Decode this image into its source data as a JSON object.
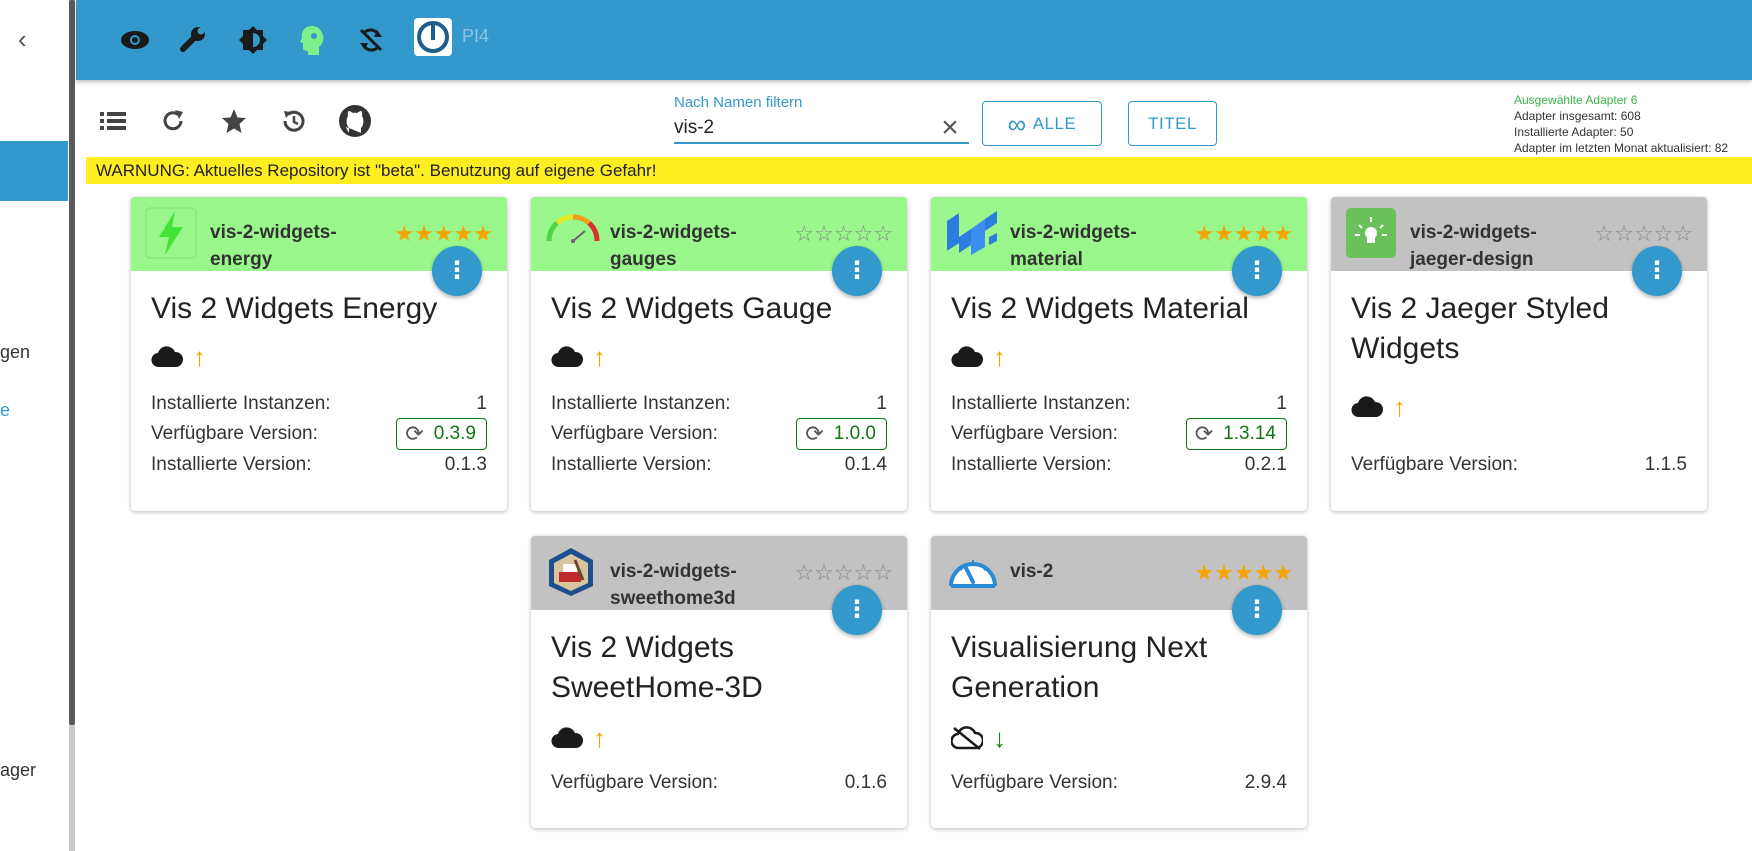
{
  "sidebar": {
    "fragments": [
      "gen",
      "e",
      "ager"
    ]
  },
  "appbar": {
    "host": "PI4",
    "icons": [
      "eye-icon",
      "wrench-icon",
      "theme-icon",
      "expert-mode-icon",
      "sync-off-icon"
    ]
  },
  "toolbar": {
    "filter_label": "Nach Namen filtern",
    "filter_value": "vis-2",
    "all_button": "ALLE",
    "title_button": "TITEL",
    "stats": {
      "selected": "Ausgewählte Adapter 6",
      "total": "Adapter insgesamt: 608",
      "installed": "Installierte Adapter: 50",
      "updated": "Adapter im letzten Monat aktualisiert: 82"
    }
  },
  "warning": "WARNUNG: Aktuelles Repository ist \"beta\". Benutzung auf eigene Gefahr!",
  "labels": {
    "instances": "Installierte Instanzen:",
    "available": "Verfügbare Version:",
    "installed": "Installierte Version:"
  },
  "cards": [
    {
      "name": "vis-2-widgets-energy",
      "title": "Vis 2 Widgets Energy",
      "stars": "★★★★★",
      "instances": "1",
      "available": "0.3.9",
      "installed": "0.1.3",
      "icon": "lightning-icon",
      "header_color": "#99f78b"
    },
    {
      "name": "vis-2-widgets-gauges",
      "title": "Vis 2 Widgets Gauge",
      "stars": "☆☆☆☆☆",
      "instances": "1",
      "available": "1.0.0",
      "installed": "0.1.4",
      "icon": "gauge-icon",
      "header_color": "#99f78b"
    },
    {
      "name": "vis-2-widgets-material",
      "title": "Vis 2 Widgets Material",
      "stars": "★★★★★",
      "instances": "1",
      "available": "1.3.14",
      "installed": "0.2.1",
      "icon": "material-logo-icon",
      "header_color": "#99f78b"
    },
    {
      "name": "vis-2-widgets-jaeger-design",
      "title": "Vis 2 Jaeger Styled Widgets",
      "stars": "☆☆☆☆☆",
      "available": "1.1.5",
      "icon": "lamp-icon",
      "header_color": "#c2c2c2"
    },
    {
      "name": "vis-2-widgets-sweethome3d",
      "title": "Vis 2 Widgets SweetHome-3D",
      "stars": "☆☆☆☆☆",
      "available": "0.1.6",
      "icon": "sweethome-icon",
      "header_color": "#c2c2c2"
    },
    {
      "name": "vis-2",
      "title": "Visualisierung Next Generation",
      "stars": "★★★★★",
      "available": "2.9.4",
      "icon": "speedometer-icon",
      "header_color": "#c2c2c2"
    }
  ]
}
